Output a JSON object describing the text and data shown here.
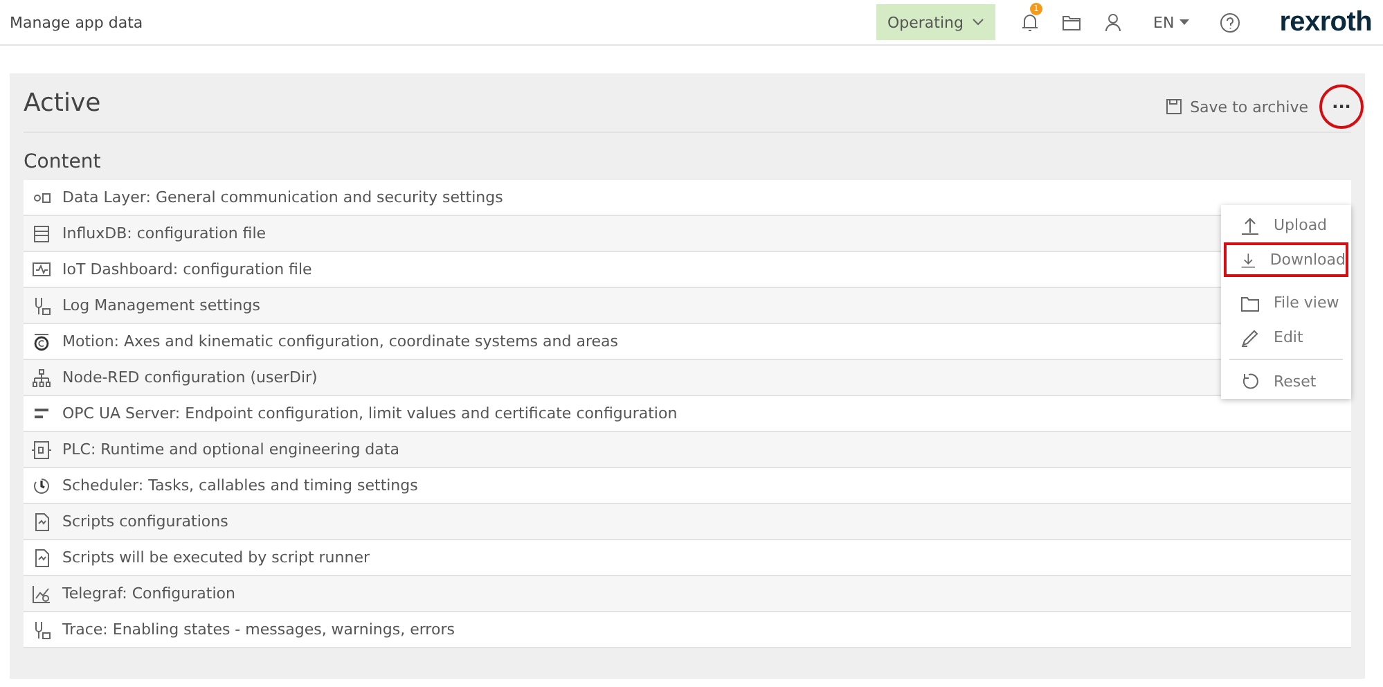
{
  "header": {
    "title": "Manage app data",
    "status": "Operating",
    "notification_count": "1",
    "language": "EN",
    "logo": "rexroth"
  },
  "panel": {
    "title": "Active",
    "save_label": "Save to archive",
    "more_label": "···",
    "more_highlighted": true,
    "section": "Content",
    "items": [
      {
        "label": "Data Layer: General communication and security settings"
      },
      {
        "label": "InfluxDB: configuration file"
      },
      {
        "label": "IoT Dashboard: configuration file"
      },
      {
        "label": "Log Management settings"
      },
      {
        "label": "Motion: Axes and kinematic configuration, coordinate systems and areas"
      },
      {
        "label": "Node-RED configuration (userDir)"
      },
      {
        "label": "OPC UA Server: Endpoint configuration, limit values and certificate configuration"
      },
      {
        "label": "PLC: Runtime and optional engineering data"
      },
      {
        "label": "Scheduler: Tasks, callables and timing settings"
      },
      {
        "label": "Scripts configurations"
      },
      {
        "label": "Scripts will be executed by script runner"
      },
      {
        "label": "Telegraf: Configuration"
      },
      {
        "label": "Trace: Enabling states - messages, warnings, errors"
      }
    ]
  },
  "menu": [
    {
      "label": "Upload",
      "highlighted": false,
      "divider_before": false
    },
    {
      "label": "Download",
      "highlighted": true,
      "divider_before": false
    },
    {
      "label": "File view",
      "highlighted": false,
      "divider_before": false
    },
    {
      "label": "Edit",
      "highlighted": false,
      "divider_before": false
    },
    {
      "label": "Reset",
      "highlighted": false,
      "divider_before": true
    }
  ]
}
